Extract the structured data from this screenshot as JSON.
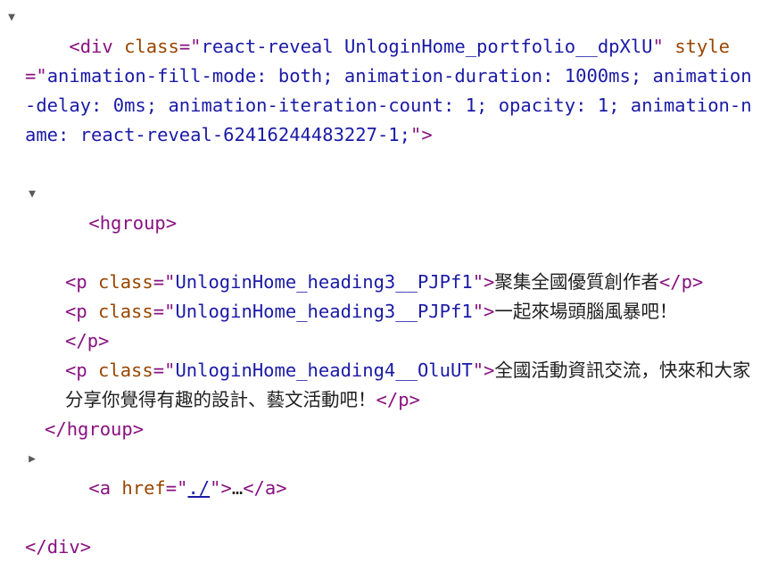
{
  "elements": {
    "div_open": {
      "tag": "div",
      "class_attr": "class",
      "class_value": "react-reveal UnloginHome_portfolio__dpXlU",
      "style_attr": "style",
      "style_value": "animation-fill-mode: both; animation-duration: 1000ms; animation-delay: 0ms; animation-iteration-count: 1; opacity: 1; animation-name: react-reveal-62416244483227-1;",
      "toggle": "▼"
    },
    "hgroup": {
      "tag": "hgroup",
      "toggle": "▼"
    },
    "p1": {
      "tag": "p",
      "class_attr": "class",
      "class_value": "UnloginHome_heading3__PJPf1",
      "text": "聚集全國優質創作者"
    },
    "p2": {
      "tag": "p",
      "class_attr": "class",
      "class_value": "UnloginHome_heading3__PJPf1",
      "text": "一起來場頭腦風暴吧！"
    },
    "p3": {
      "tag": "p",
      "class_attr": "class",
      "class_value": "UnloginHome_heading4__OluUT",
      "text": "全國活動資訊交流，快來和大家分享你覺得有趣的設計、藝文活動吧！"
    },
    "a": {
      "tag": "a",
      "href_attr": "href",
      "href_value": "./",
      "ellipsis": "…",
      "toggle": "▶"
    }
  },
  "punct": {
    "lt": "<",
    "gt": ">",
    "close_lt": "</",
    "eq_quote": "=\"",
    "quote": "\"",
    "space": " "
  },
  "colors": {
    "tag": "#881280",
    "attribute": "#994500",
    "value": "#1a1aa6",
    "text": "#1f1f1f",
    "toggle": "#5a5a5a"
  }
}
